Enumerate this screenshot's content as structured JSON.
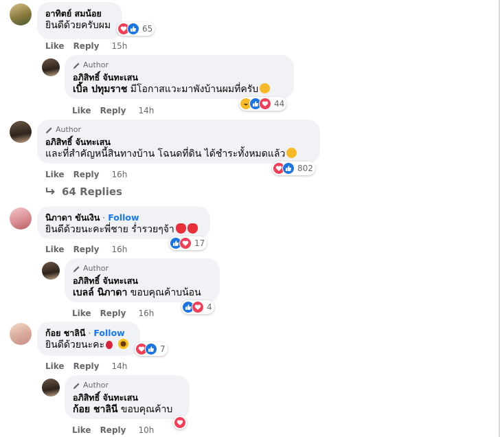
{
  "comments": [
    {
      "name": "อาทิตย์ สมน้อย",
      "text": "ยินดีด้วยครับผม",
      "count": "65",
      "like": "Like",
      "reply": "Reply",
      "time": "15h"
    },
    {
      "author_tag": "Author",
      "name": "อภิสิทธิ์ จันทะเสน",
      "mention": "เบิ้ล ปทุมราช",
      "text": " มีโอกาสแวะมาพังบ้านผมที่ครับ",
      "count": "44",
      "like": "Like",
      "reply": "Reply",
      "time": "14h"
    },
    {
      "author_tag": "Author",
      "name": "อภิสิทธิ์ จันทะเสน",
      "text": "และที่สำคัญหนี้สินทางบ้าน โฉนดที่ดิน ได้ชำระทั้งหมดแล้ว",
      "count": "802",
      "like": "Like",
      "reply": "Reply",
      "time": "16h"
    },
    {
      "name": "นิภาดา ขันเงิน",
      "follow_sep": " · ",
      "follow": "Follow",
      "text": "ยินดีด้วยนะคะพี่ชาย ร่ำรวยๆจ้า",
      "count": "17",
      "like": "Like",
      "reply": "Reply",
      "time": "16h"
    },
    {
      "author_tag": "Author",
      "name": "อภิสิทธิ์ จันทะเสน",
      "mention": "เบลล์ นิภาดา",
      "text": " ขอบคุณค้าบน้อน",
      "count": "4",
      "like": "Like",
      "reply": "Reply",
      "time": "16h"
    },
    {
      "name": "ก้อย ชาลินี",
      "follow_sep": " · ",
      "follow": "Follow",
      "text": "ยินดีด้วยนะคะ",
      "count": "7",
      "like": "Like",
      "reply": "Reply",
      "time": "14h"
    },
    {
      "author_tag": "Author",
      "name": "อภิสิทธิ์ จันทะเสน",
      "mention": "ก้อย ชาลินี",
      "text": " ขอบคุณค้าบ",
      "like": "Like",
      "reply": "Reply",
      "time": "10h"
    }
  ],
  "replies_link": {
    "label": "64 Replies"
  },
  "colors": {
    "love": "#f33e58",
    "like": "#1b74e4",
    "haha": "#f7b928",
    "link": "#1877f2",
    "bubble": "#f0f2f5"
  }
}
